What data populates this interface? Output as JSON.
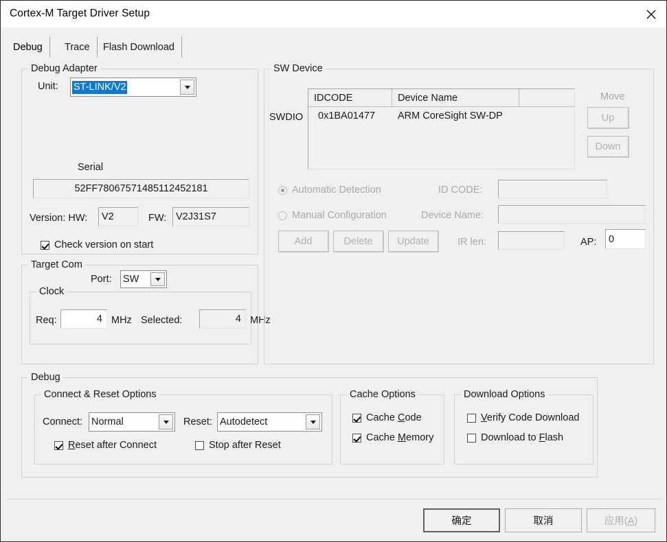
{
  "window": {
    "title": "Cortex-M Target Driver Setup",
    "close_icon": "close-icon"
  },
  "tabs": [
    {
      "label": "Debug",
      "selected": true
    },
    {
      "label": "Trace",
      "selected": false
    },
    {
      "label": "Flash Download",
      "selected": false
    }
  ],
  "debug_adapter": {
    "legend": "Debug Adapter",
    "unit_label": "Unit:",
    "unit_value": "ST-LINK/V2",
    "serial_label": "Serial",
    "serial_value": "52FF78067571485112452181",
    "version_label": "Version: HW:",
    "hw_value": "V2",
    "fw_label": "FW:",
    "fw_value": "V2J31S7",
    "check_version_label": "Check version on start",
    "check_version_checked": true
  },
  "target_com": {
    "legend": "Target Com",
    "port_label": "Port:",
    "port_value": "SW",
    "clock_legend": "Clock",
    "req_label": "Req:",
    "req_value": "4",
    "req_unit": "MHz",
    "selected_label": "Selected:",
    "selected_value": "4",
    "selected_unit": "MHz"
  },
  "sw_device": {
    "legend": "SW Device",
    "bus_label": "SWDIO",
    "columns": [
      "IDCODE",
      "Device Name",
      ""
    ],
    "rows": [
      {
        "idcode": "0x1BA01477",
        "device_name": "ARM CoreSight SW-DP",
        "extra": ""
      }
    ],
    "move_label": "Move",
    "up_label": "Up",
    "down_label": "Down",
    "automatic_detection_label": "Automatic Detection",
    "automatic_detection_selected": true,
    "manual_configuration_label": "Manual Configuration",
    "manual_configuration_selected": false,
    "id_code_label": "ID CODE:",
    "id_code_value": "",
    "device_name_label": "Device Name:",
    "device_name_value": "",
    "ir_len_label": "IR len:",
    "ir_len_value": "",
    "ap_label": "AP:",
    "ap_value": "0",
    "add_label": "Add",
    "delete_label": "Delete",
    "update_label": "Update"
  },
  "debug_section": {
    "legend": "Debug",
    "connect_reset": {
      "legend": "Connect & Reset Options",
      "connect_label": "Connect:",
      "connect_value": "Normal",
      "reset_label": "Reset:",
      "reset_value": "Autodetect",
      "reset_after_connect_label_pre": "",
      "reset_after_connect_accel": "R",
      "reset_after_connect_label_post": "eset after Connect",
      "reset_after_connect_checked": true,
      "stop_after_reset_label": "Stop after Reset",
      "stop_after_reset_checked": false
    },
    "cache_options": {
      "legend": "Cache Options",
      "cache_code_pre": "Cache ",
      "cache_code_accel": "C",
      "cache_code_post": "ode",
      "cache_code_checked": true,
      "cache_memory_pre": "Cache ",
      "cache_memory_accel": "M",
      "cache_memory_post": "emory",
      "cache_memory_checked": true
    },
    "download_options": {
      "legend": "Download Options",
      "verify_pre": "",
      "verify_accel": "V",
      "verify_post": "erify Code Download",
      "verify_checked": false,
      "download_pre": "Download to ",
      "download_accel": "F",
      "download_post": "lash",
      "download_checked": false
    }
  },
  "footer": {
    "ok_label": "确定",
    "cancel_label": "取消",
    "apply_label_pre": "应用(",
    "apply_accel": "A",
    "apply_label_post": ")",
    "apply_disabled": true
  },
  "colors": {
    "dialog_bg": "#f0f0f0",
    "titlebar_bg": "#ffffff",
    "selection_blue": "#0a7ad4",
    "text": "#1a1a1a",
    "disabled_text": "#a8a8a8",
    "group_border": "#d2d2d2"
  }
}
